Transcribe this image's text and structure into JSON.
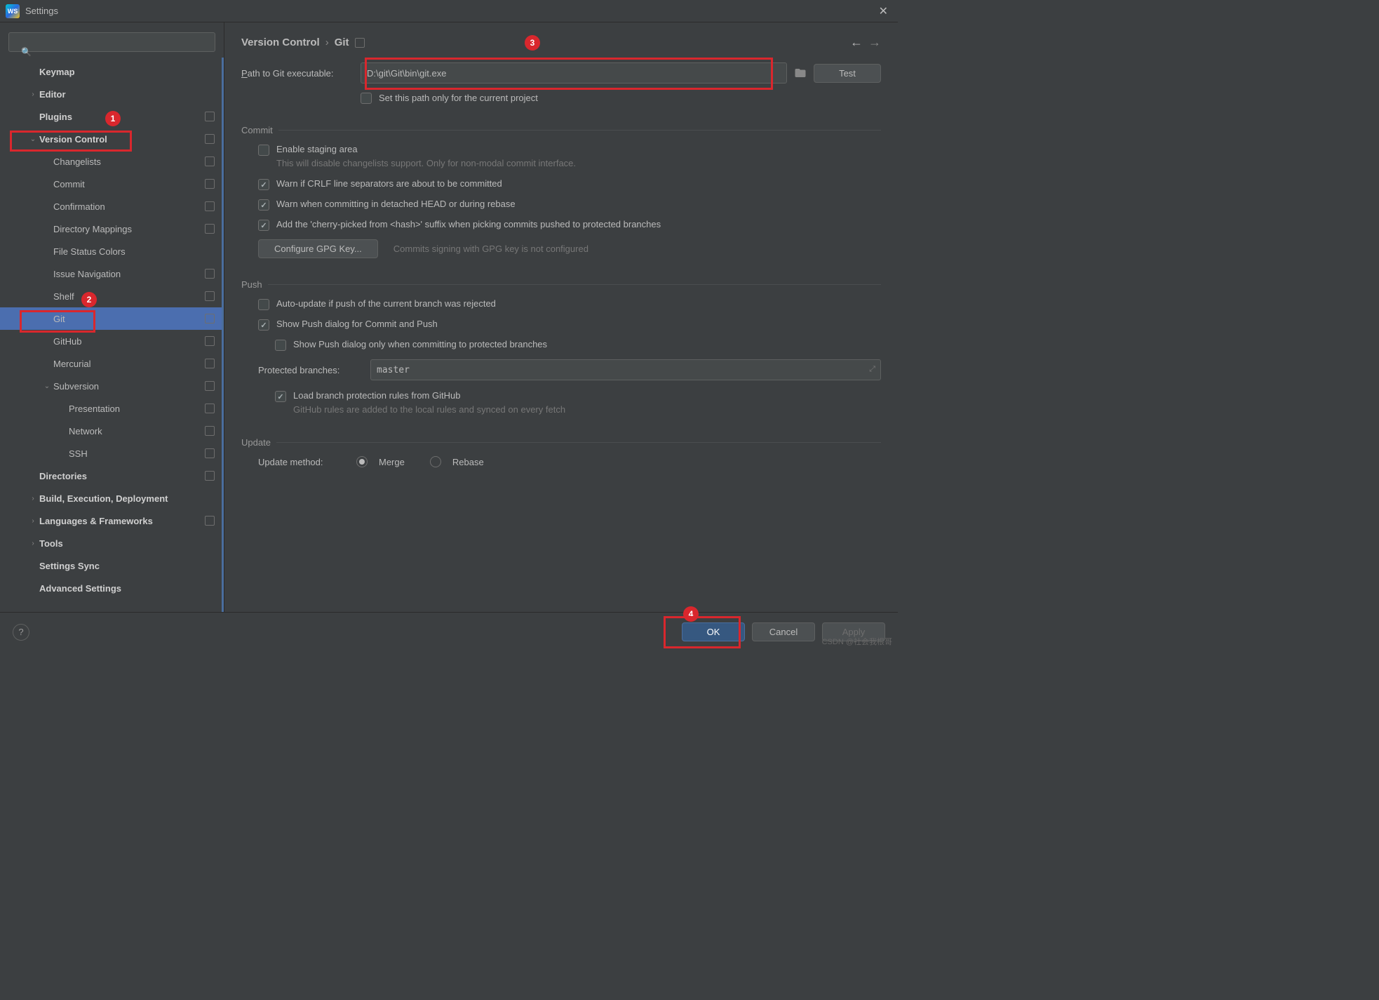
{
  "window": {
    "title": "Settings"
  },
  "sidebar": {
    "items": [
      {
        "label": "Keymap",
        "indent": 1,
        "bold": true
      },
      {
        "label": "Editor",
        "indent": 1,
        "bold": true,
        "arrow": ">"
      },
      {
        "label": "Plugins",
        "indent": 1,
        "bold": true,
        "square": true
      },
      {
        "label": "Version Control",
        "indent": 1,
        "bold": true,
        "arrow": "v",
        "square": true
      },
      {
        "label": "Changelists",
        "indent": 2,
        "square": true
      },
      {
        "label": "Commit",
        "indent": 2,
        "square": true
      },
      {
        "label": "Confirmation",
        "indent": 2,
        "square": true
      },
      {
        "label": "Directory Mappings",
        "indent": 2,
        "square": true
      },
      {
        "label": "File Status Colors",
        "indent": 2
      },
      {
        "label": "Issue Navigation",
        "indent": 2,
        "square": true
      },
      {
        "label": "Shelf",
        "indent": 2,
        "square": true
      },
      {
        "label": "Git",
        "indent": 2,
        "square": true,
        "selected": true
      },
      {
        "label": "GitHub",
        "indent": 2,
        "square": true
      },
      {
        "label": "Mercurial",
        "indent": 2,
        "square": true
      },
      {
        "label": "Subversion",
        "indent": 2,
        "arrow": "v",
        "square": true
      },
      {
        "label": "Presentation",
        "indent": 3,
        "square": true
      },
      {
        "label": "Network",
        "indent": 3,
        "square": true
      },
      {
        "label": "SSH",
        "indent": 3,
        "square": true
      },
      {
        "label": "Directories",
        "indent": 1,
        "bold": true,
        "square": true
      },
      {
        "label": "Build, Execution, Deployment",
        "indent": 1,
        "bold": true,
        "arrow": ">"
      },
      {
        "label": "Languages & Frameworks",
        "indent": 1,
        "bold": true,
        "arrow": ">",
        "square": true
      },
      {
        "label": "Tools",
        "indent": 1,
        "bold": true,
        "arrow": ">"
      },
      {
        "label": "Settings Sync",
        "indent": 1,
        "bold": true
      },
      {
        "label": "Advanced Settings",
        "indent": 1,
        "bold": true
      }
    ]
  },
  "breadcrumb": {
    "a": "Version Control",
    "b": "Git"
  },
  "path": {
    "label_pre": "P",
    "label_rest": "ath to Git executable:",
    "value": "D:\\git\\Git\\bin\\git.exe",
    "test": "Test",
    "only_current": "Set this path only for the current project"
  },
  "commit": {
    "title": "Commit",
    "enable_staging": "Enable staging area",
    "enable_hint": "This will disable changelists support. Only for non-modal commit interface.",
    "warn_crlf": "Warn if CRLF line separators are about to be committed",
    "warn_detached": "Warn when committing in detached HEAD or during rebase",
    "cherry": "Add the 'cherry-picked from <hash>' suffix when picking commits pushed to protected branches",
    "gpg_btn": "Configure GPG Key...",
    "gpg_status": "Commits signing with GPG key is not configured"
  },
  "push": {
    "title": "Push",
    "auto_update": "Auto-update if push of the current branch was rejected",
    "show_push": "Show Push dialog for Commit and Push",
    "show_push_protected": "Show Push dialog only when committing to protected branches",
    "protected_label": "Protected branches:",
    "protected_value": "master",
    "load_rules": "Load branch protection rules from GitHub",
    "load_hint": "GitHub rules are added to the local rules and synced on every fetch"
  },
  "update": {
    "title": "Update",
    "method_label": "Update method:",
    "merge": "Merge",
    "rebase": "Rebase"
  },
  "footer": {
    "ok": "OK",
    "cancel": "Cancel",
    "apply": "Apply"
  },
  "annotations": {
    "b1": "1",
    "b2": "2",
    "b3": "3",
    "b4": "4"
  },
  "watermark": "CSDN @社会我根哥"
}
